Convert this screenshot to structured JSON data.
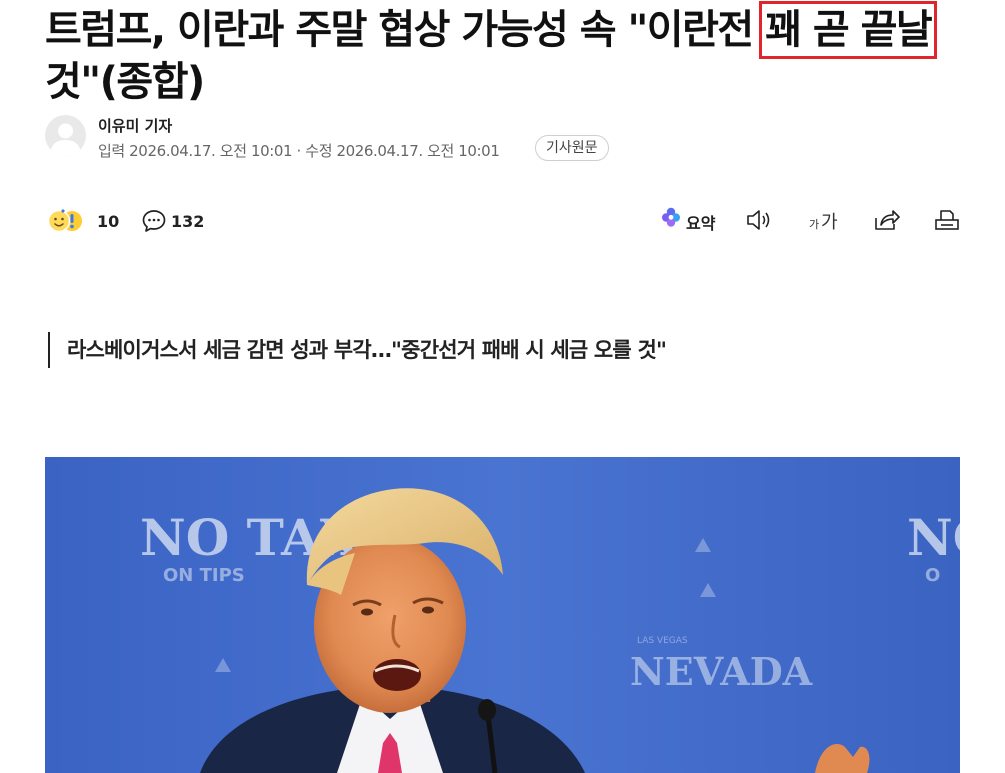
{
  "article": {
    "headline_before": "트럼프, 이란과 주말 협상 가능성 속 \"이란전 ",
    "headline_highlight": "꽤 곧 끝날",
    "headline_after": " 것\"(종합)",
    "reporter": "이유미 기자",
    "dates": "입력 2026.04.17. 오전 10:01 · 수정 2026.04.17. 오전 10:01",
    "source_button": "기사원문",
    "subheadline": "라스베이거스서 세금 감면 성과 부각…\"중간선거 패배 시 세금 오를 것\""
  },
  "toolbar": {
    "reaction_count": "10",
    "comment_count": "132",
    "summary_label": "요약",
    "font_small": "가",
    "font_big": "가"
  },
  "photo": {
    "sign_left_line1": "NO TAX",
    "sign_left_line2": "ON TIPS",
    "sign_right_line1": "NO",
    "sign_right_line2": "O",
    "sign_center_small": "LAS VEGAS",
    "sign_center_big": "NEVADA"
  },
  "colors": {
    "highlight_border": "#e0252c",
    "photo_background": "#3d67c7",
    "summary_icon": "#5b6cf0"
  }
}
